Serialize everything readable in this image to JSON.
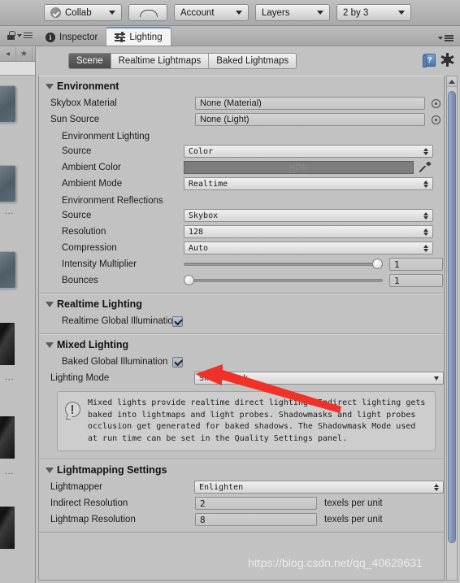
{
  "toolbar": {
    "collab": "Collab",
    "cloud_icon": "cloud-icon",
    "account": "Account",
    "layers": "Layers",
    "layout": "2 by 3"
  },
  "tabbar": {
    "inspector": "Inspector",
    "lighting": "Lighting"
  },
  "lighting_window": {
    "modes": [
      {
        "label": "Scene",
        "selected": true
      },
      {
        "label": "Realtime Lightmaps",
        "selected": false
      },
      {
        "label": "Baked Lightmaps",
        "selected": false
      }
    ],
    "help_label": "?",
    "sections": {
      "environment": {
        "title": "Environment",
        "skybox_material_label": "Skybox Material",
        "skybox_material_value": "None (Material)",
        "sun_source_label": "Sun Source",
        "sun_source_value": "None (Light)",
        "env_lighting_group": "Environment Lighting",
        "source_label": "Source",
        "source_value": "Color",
        "ambient_color_label": "Ambient Color",
        "ambient_color_value": "HDR",
        "ambient_color_hex": "#7d7d7d",
        "ambient_mode_label": "Ambient Mode",
        "ambient_mode_value": "Realtime",
        "env_reflections_group": "Environment Reflections",
        "refl_source_label": "Source",
        "refl_source_value": "Skybox",
        "resolution_label": "Resolution",
        "resolution_value": "128",
        "compression_label": "Compression",
        "compression_value": "Auto",
        "intensity_label": "Intensity Multiplier",
        "intensity_value": "1",
        "bounces_label": "Bounces",
        "bounces_value": "1"
      },
      "realtime_lighting": {
        "title": "Realtime Lighting",
        "realtime_gi_label": "Realtime Global Illumination",
        "realtime_gi_checked": true
      },
      "mixed_lighting": {
        "title": "Mixed Lighting",
        "baked_gi_label": "Baked Global Illumination",
        "baked_gi_checked": true,
        "lighting_mode_label": "Lighting Mode",
        "lighting_mode_value": "Shadowmask",
        "info_text": "Mixed lights provide realtime direct lighting. Indirect lighting gets baked into lightmaps and light probes. Shadowmasks and light probes occlusion get generated for baked shadows. The Shadowmask Mode used at run time can be set in the Quality Settings panel."
      },
      "lightmapping_settings": {
        "title": "Lightmapping Settings",
        "lightmapper_label": "Lightmapper",
        "lightmapper_value": "Enlighten",
        "indirect_resolution_label": "Indirect Resolution",
        "indirect_resolution_value": "2",
        "indirect_resolution_suffix": "texels per unit",
        "lightmap_resolution_label": "Lightmap Resolution",
        "lightmap_resolution_value": "8",
        "lightmap_resolution_suffix": "texels per unit"
      }
    }
  },
  "left_panel": {
    "ellipsis": "...",
    "star_icon": "star-icon"
  },
  "annotation": {
    "arrow_color": "#f03127"
  },
  "watermark": "https://blog.csdn.net/qq_40629631"
}
